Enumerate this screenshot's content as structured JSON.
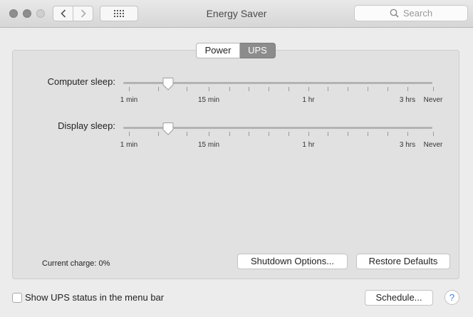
{
  "window": {
    "title": "Energy Saver"
  },
  "search": {
    "placeholder": "Search"
  },
  "tabs": [
    {
      "label": "Power"
    },
    {
      "label": "UPS"
    }
  ],
  "computer_sleep": {
    "label": "Computer sleep:",
    "tick_labels": [
      "1 min",
      "15 min",
      "1 hr",
      "3 hrs",
      "Never"
    ]
  },
  "display_sleep": {
    "label": "Display sleep:",
    "tick_labels": [
      "1 min",
      "15 min",
      "1 hr",
      "3 hrs",
      "Never"
    ]
  },
  "status": {
    "charge": "Current charge: 0%"
  },
  "buttons": {
    "shutdown_options": "Shutdown Options...",
    "restore_defaults": "Restore Defaults",
    "schedule": "Schedule..."
  },
  "footer": {
    "show_status_label": "Show UPS status in the menu bar"
  },
  "help": {
    "label": "?"
  },
  "colors": {
    "help": "#3b7ce3",
    "selected_tab": "#8c8c8c"
  }
}
